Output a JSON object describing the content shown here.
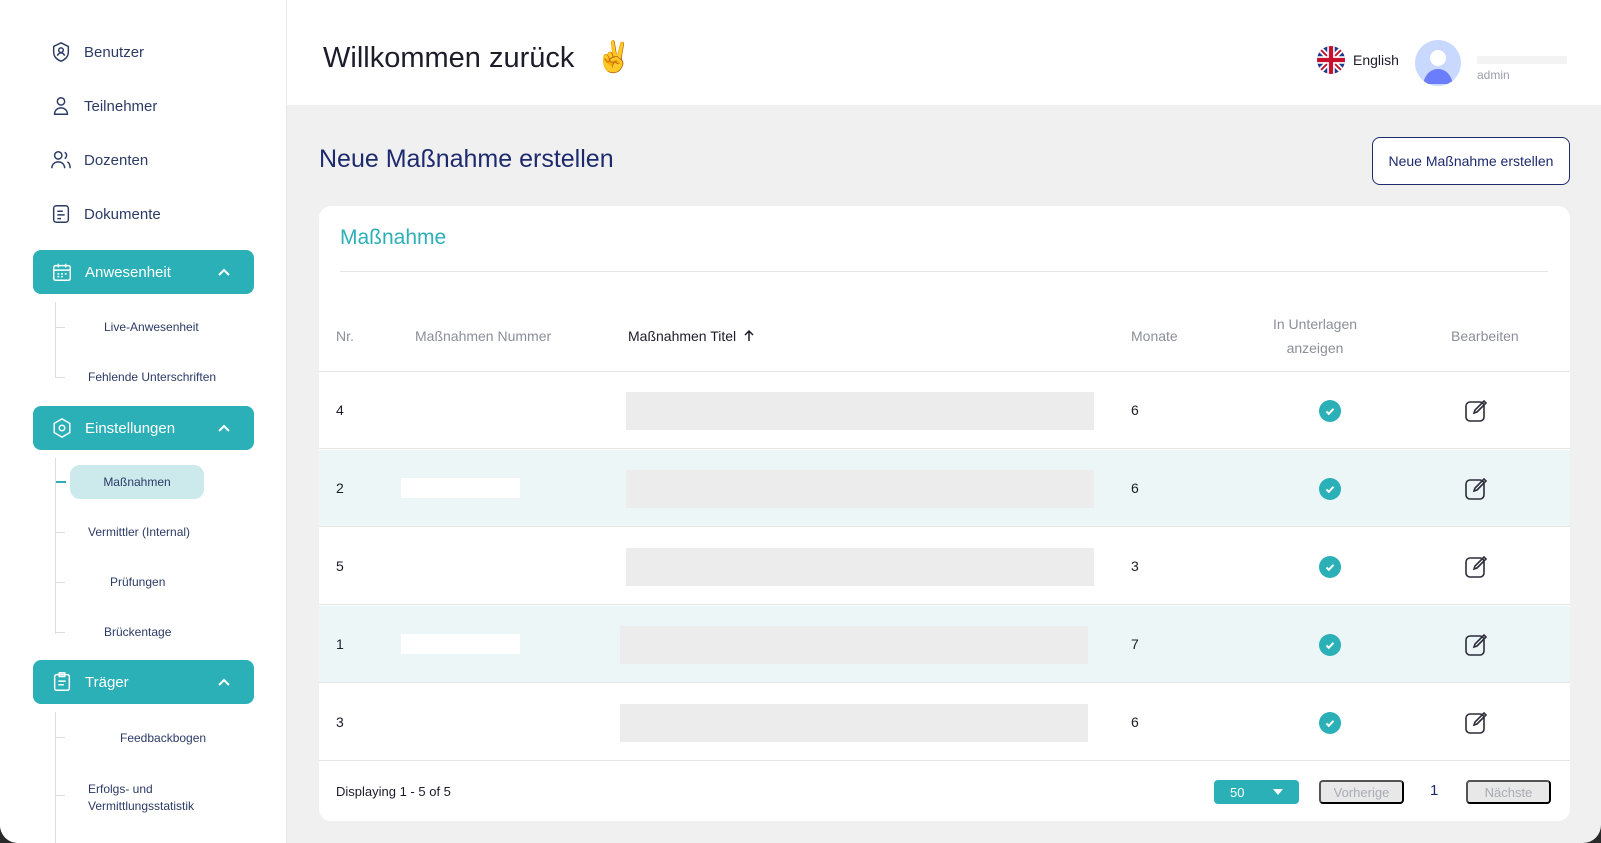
{
  "sidebar": {
    "items": [
      {
        "label": "Benutzer",
        "icon": "user-shield-icon"
      },
      {
        "label": "Teilnehmer",
        "icon": "person-icon"
      },
      {
        "label": "Dozenten",
        "icon": "people-icon"
      },
      {
        "label": "Dokumente",
        "icon": "document-icon"
      }
    ],
    "groups": [
      {
        "label": "Anwesenheit",
        "icon": "calendar-icon",
        "children": [
          "Live-Anwesenheit",
          "Fehlende Unterschriften"
        ]
      },
      {
        "label": "Einstellungen",
        "icon": "settings-icon",
        "children": [
          "Maßnahmen",
          "Vermittler (Internal)",
          "Prüfungen",
          "Brückentage"
        ]
      },
      {
        "label": "Träger",
        "icon": "clipboard-icon",
        "children": [
          "Feedbackbogen",
          "Erfolgs- und Vermittlungsstatistik"
        ]
      }
    ]
  },
  "header": {
    "welcome": "Willkommen zurück",
    "emoji": "✌️",
    "language": "English",
    "user_role": "admin"
  },
  "main": {
    "page_title": "Neue Maßnahme erstellen",
    "create_button": "Neue Maßnahme erstellen",
    "card_title": "Maßnahme",
    "columns": [
      "Nr.",
      "Maßnahmen Nummer",
      "Maßnahmen Titel",
      "Monate",
      "In Unterlagen anzeigen",
      "Bearbeiten"
    ],
    "rows": [
      {
        "nr": "4",
        "monate": "6",
        "show": true
      },
      {
        "nr": "2",
        "monate": "6",
        "show": true
      },
      {
        "nr": "5",
        "monate": "3",
        "show": true
      },
      {
        "nr": "1",
        "monate": "7",
        "show": true
      },
      {
        "nr": "3",
        "monate": "6",
        "show": true
      }
    ]
  },
  "pagination": {
    "displaying": "Displaying 1 - 5 of 5",
    "per_page": "50",
    "prev": "Vorherige",
    "page": "1",
    "next": "Nächste"
  },
  "colors": {
    "accent": "#2bb0b8",
    "primary": "#1d2a6e"
  }
}
